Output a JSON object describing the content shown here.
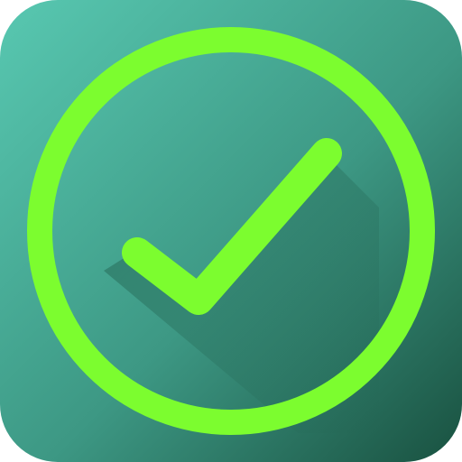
{
  "app_icon": {
    "icon_name": "checkmark-circle-icon",
    "colors": {
      "tile_gradient_start": "#58c8b1",
      "tile_gradient_mid": "#3d9884",
      "tile_gradient_end": "#195140",
      "ring_and_check": "#7cfd2f",
      "shadow": "#1f5c4a"
    }
  }
}
